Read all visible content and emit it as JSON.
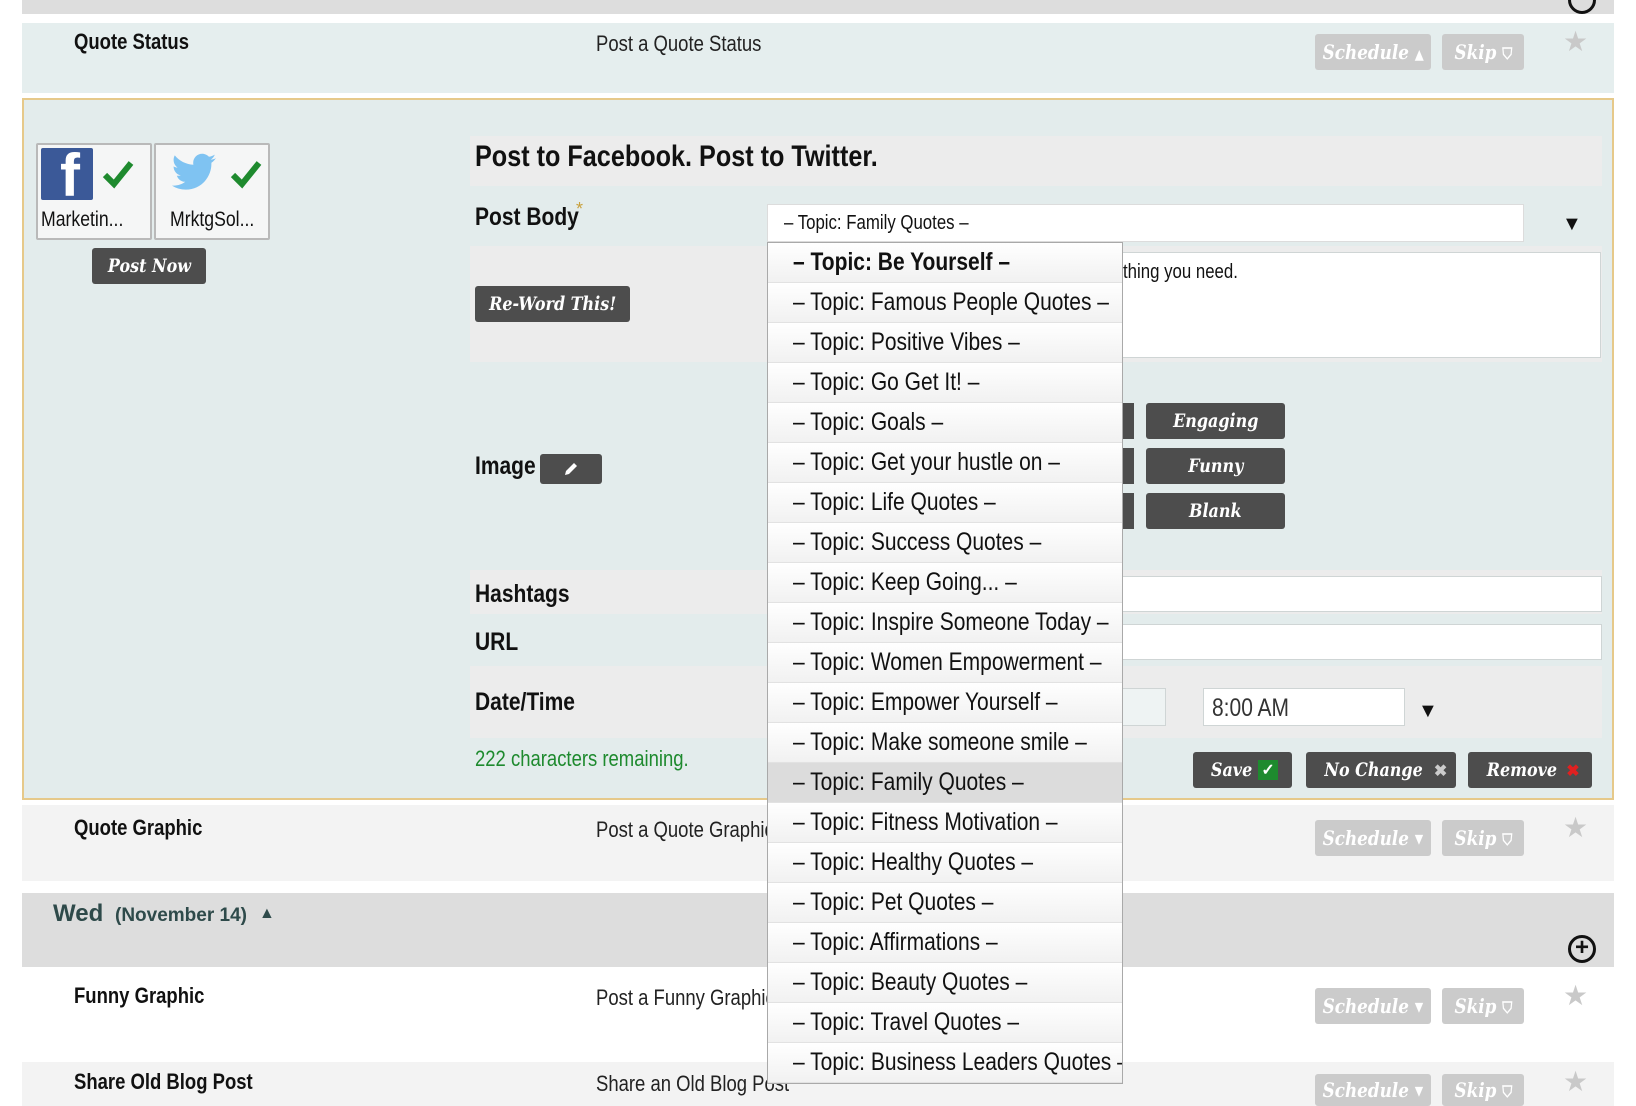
{
  "rows": {
    "quote_status": {
      "title": "Quote Status",
      "desc": "Post a Quote Status"
    },
    "quote_graphic": {
      "title": "Quote Graphic",
      "desc": "Post a Quote Graphic"
    },
    "funny_graphic": {
      "title": "Funny Graphic",
      "desc": "Post a Funny Graphic"
    },
    "share_old_blog": {
      "title": "Share Old Blog Post",
      "desc": "Share an Old Blog Post"
    }
  },
  "row_buttons": {
    "schedule": "Schedule",
    "skip": "Skip",
    "schedule_up_arrow": "▲",
    "schedule_down_arrow": "▾",
    "skip_icon": "thumbs-down-icon"
  },
  "day_header": {
    "day": "Wed",
    "date": "(November 14)",
    "arrow": "▲"
  },
  "editor": {
    "heading": "Post to Facebook. Post to Twitter.",
    "accounts": [
      {
        "name": "Marketin...",
        "network": "facebook"
      },
      {
        "name": "MrktgSol...",
        "network": "twitter"
      }
    ],
    "post_now": "Post Now",
    "reword": "Re-Word This!",
    "labels": {
      "post_body": "Post Body",
      "required": "*",
      "image": "Image",
      "hashtags": "Hashtags",
      "url": "URL",
      "date_time": "Date/Time"
    },
    "topic_select_value": "– Topic: Family Quotes –",
    "post_body_visible_text": "thing you need.",
    "image_style_buttons": [
      "Engaging",
      "Funny",
      "Blank"
    ],
    "time_value": "8:00 AM",
    "chars_remaining": "222 characters remaining.",
    "actions": {
      "save": "Save",
      "no_change": "No Change",
      "remove": "Remove"
    }
  },
  "topic_options": [
    "– Topic: Be Yourself –",
    "– Topic: Famous People Quotes –",
    "– Topic: Positive Vibes –",
    "– Topic: Go Get It! –",
    "– Topic: Goals –",
    "– Topic: Get your hustle on –",
    "– Topic: Life Quotes –",
    "– Topic: Success Quotes –",
    "– Topic: Keep Going... –",
    "– Topic: Inspire Someone Today –",
    "– Topic: Women Empowerment –",
    "– Topic: Empower Yourself –",
    "– Topic: Make someone smile –",
    "– Topic: Family Quotes –",
    "– Topic: Fitness Motivation –",
    "– Topic: Healthy Quotes –",
    "– Topic: Pet Quotes –",
    "– Topic: Affirmations –",
    "– Topic: Beauty Quotes –",
    "– Topic: Travel Quotes –",
    "– Topic: Business Leaders Quotes –"
  ],
  "topic_highlighted_index": 0,
  "topic_selected_index": 13,
  "colors": {
    "accent_green": "#1e8a2e",
    "button_dark": "#4d4d4d",
    "button_light": "#cbcbcb",
    "panel_bg": "#e3ecec",
    "panel_border": "#e6c98a",
    "facebook_blue": "#3b5998",
    "twitter_blue": "#55acee"
  }
}
